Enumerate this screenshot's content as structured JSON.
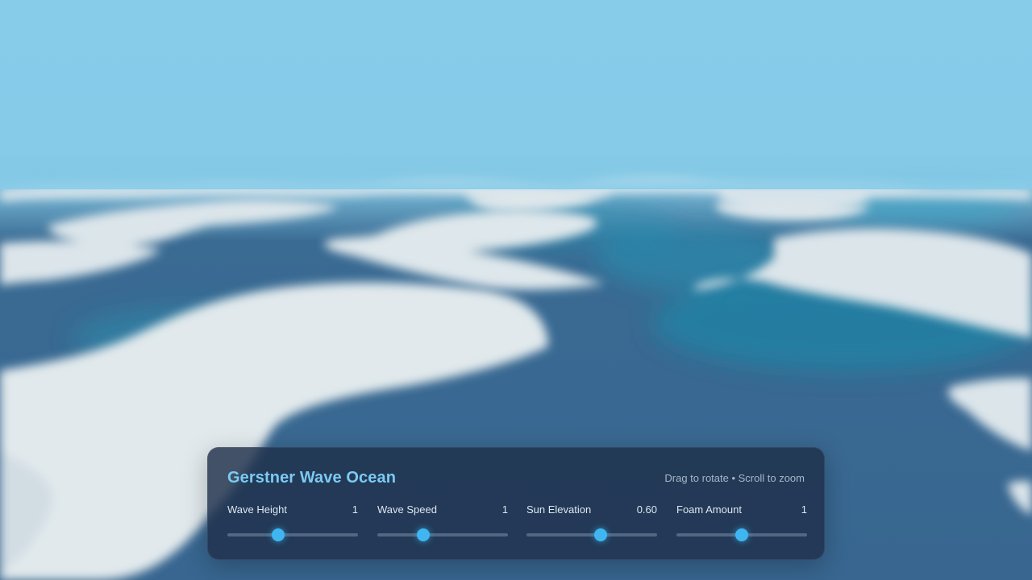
{
  "panel": {
    "title": "Gerstner Wave Ocean",
    "hint": "Drag to rotate • Scroll to zoom"
  },
  "controls": [
    {
      "label": "Wave Height",
      "value": "1",
      "level": 0.39
    },
    {
      "label": "Wave Speed",
      "value": "1",
      "level": 0.35
    },
    {
      "label": "Sun Elevation",
      "value": "0.60",
      "level": 0.57
    },
    {
      "label": "Foam Amount",
      "value": "1",
      "level": 0.5
    }
  ],
  "colors": {
    "sky": "#87cdea",
    "water": "#386690",
    "foam": "#dfe7ea",
    "accent": "#3fb6f2",
    "title": "#7ccbf2"
  }
}
